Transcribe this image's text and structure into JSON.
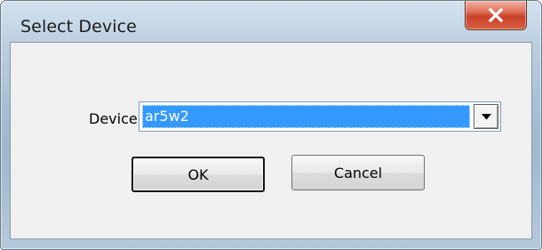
{
  "window": {
    "title": "Select Device"
  },
  "form": {
    "device_label": "Device:",
    "device_value": "ar5w2"
  },
  "buttons": {
    "ok_label": "OK",
    "cancel_label": "Cancel"
  },
  "icons": {
    "close": "close-icon",
    "dropdown": "chevron-down-icon"
  },
  "colors": {
    "selection": "#3399ff",
    "close_button": "#c9412b"
  }
}
